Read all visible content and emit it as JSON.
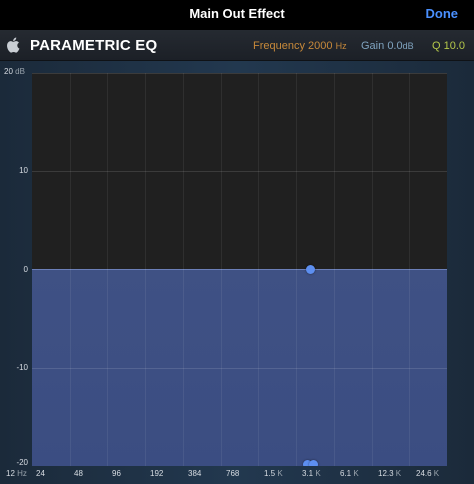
{
  "topbar": {
    "title": "Main Out Effect",
    "done_label": "Done"
  },
  "header": {
    "logo_icon": "apple-logo-icon",
    "title": "PARAMETRIC EQ",
    "frequency": {
      "label": "Frequency",
      "value": "2000",
      "unit": "Hz"
    },
    "gain": {
      "label": "Gain",
      "value": "0.0",
      "unit": "dB"
    },
    "q": {
      "label": "Q",
      "value": "10.0"
    }
  },
  "graph": {
    "y_labels": [
      {
        "value": "20",
        "unit": "dB"
      },
      {
        "value": "10",
        "unit": ""
      },
      {
        "value": "0",
        "unit": ""
      },
      {
        "value": "-10",
        "unit": ""
      },
      {
        "value": "-20",
        "unit": ""
      }
    ],
    "x_labels": [
      {
        "value": "12",
        "unit": "Hz"
      },
      {
        "value": "24",
        "unit": ""
      },
      {
        "value": "48",
        "unit": ""
      },
      {
        "value": "96",
        "unit": ""
      },
      {
        "value": "192",
        "unit": ""
      },
      {
        "value": "384",
        "unit": ""
      },
      {
        "value": "768",
        "unit": ""
      },
      {
        "value": "1.5",
        "unit": "K"
      },
      {
        "value": "3.1",
        "unit": "K"
      },
      {
        "value": "6.1",
        "unit": "K"
      },
      {
        "value": "12.3",
        "unit": "K"
      },
      {
        "value": "24.6",
        "unit": "K"
      }
    ],
    "band_frequency_hz": 2000,
    "band_gain_db": 0.0,
    "colors": {
      "fill": "#3f5184",
      "node": "#5d8ff0",
      "frequency": "#c7893a",
      "gain": "#7fa3bf",
      "q": "#b5c84a",
      "done": "#4a90ff"
    }
  }
}
